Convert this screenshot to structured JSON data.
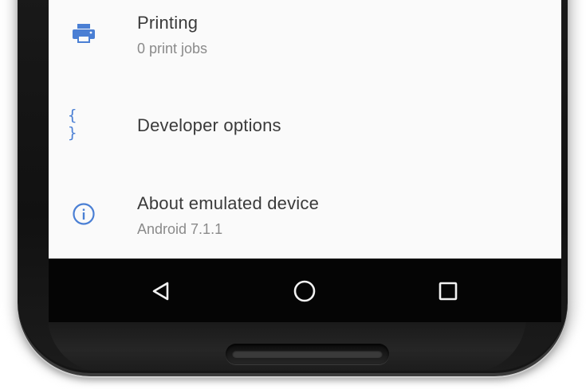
{
  "settings": {
    "items": [
      {
        "icon": "printer-icon",
        "title": "Printing",
        "subtitle": "0 print jobs"
      },
      {
        "icon": "curly-braces-icon",
        "icon_glyph": "{ }",
        "title": "Developer options",
        "subtitle": ""
      },
      {
        "icon": "info-icon",
        "title": "About emulated device",
        "subtitle": "Android 7.1.1"
      }
    ]
  },
  "navbar": {
    "back": "back-icon",
    "home": "home-icon",
    "recents": "recents-icon"
  },
  "colors": {
    "accent": "#4a7fd4",
    "screen_bg": "#fafafa",
    "title_text": "#3a3a3a",
    "subtitle_text": "#8a8a8a",
    "navbar_bg": "#050505",
    "phone_body": "#151515"
  }
}
